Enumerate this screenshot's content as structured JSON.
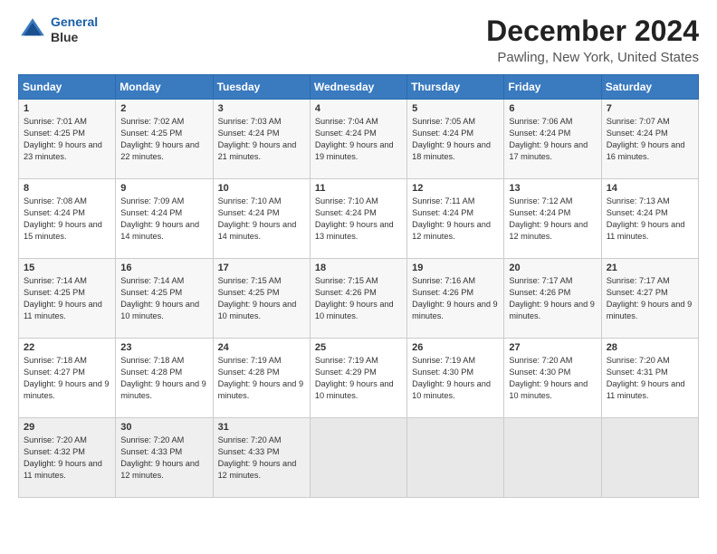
{
  "header": {
    "logo_line1": "General",
    "logo_line2": "Blue",
    "title": "December 2024",
    "subtitle": "Pawling, New York, United States"
  },
  "days_of_week": [
    "Sunday",
    "Monday",
    "Tuesday",
    "Wednesday",
    "Thursday",
    "Friday",
    "Saturday"
  ],
  "weeks": [
    [
      {
        "day": "1",
        "sunrise": "Sunrise: 7:01 AM",
        "sunset": "Sunset: 4:25 PM",
        "daylight": "Daylight: 9 hours and 23 minutes."
      },
      {
        "day": "2",
        "sunrise": "Sunrise: 7:02 AM",
        "sunset": "Sunset: 4:25 PM",
        "daylight": "Daylight: 9 hours and 22 minutes."
      },
      {
        "day": "3",
        "sunrise": "Sunrise: 7:03 AM",
        "sunset": "Sunset: 4:24 PM",
        "daylight": "Daylight: 9 hours and 21 minutes."
      },
      {
        "day": "4",
        "sunrise": "Sunrise: 7:04 AM",
        "sunset": "Sunset: 4:24 PM",
        "daylight": "Daylight: 9 hours and 19 minutes."
      },
      {
        "day": "5",
        "sunrise": "Sunrise: 7:05 AM",
        "sunset": "Sunset: 4:24 PM",
        "daylight": "Daylight: 9 hours and 18 minutes."
      },
      {
        "day": "6",
        "sunrise": "Sunrise: 7:06 AM",
        "sunset": "Sunset: 4:24 PM",
        "daylight": "Daylight: 9 hours and 17 minutes."
      },
      {
        "day": "7",
        "sunrise": "Sunrise: 7:07 AM",
        "sunset": "Sunset: 4:24 PM",
        "daylight": "Daylight: 9 hours and 16 minutes."
      }
    ],
    [
      {
        "day": "8",
        "sunrise": "Sunrise: 7:08 AM",
        "sunset": "Sunset: 4:24 PM",
        "daylight": "Daylight: 9 hours and 15 minutes."
      },
      {
        "day": "9",
        "sunrise": "Sunrise: 7:09 AM",
        "sunset": "Sunset: 4:24 PM",
        "daylight": "Daylight: 9 hours and 14 minutes."
      },
      {
        "day": "10",
        "sunrise": "Sunrise: 7:10 AM",
        "sunset": "Sunset: 4:24 PM",
        "daylight": "Daylight: 9 hours and 14 minutes."
      },
      {
        "day": "11",
        "sunrise": "Sunrise: 7:10 AM",
        "sunset": "Sunset: 4:24 PM",
        "daylight": "Daylight: 9 hours and 13 minutes."
      },
      {
        "day": "12",
        "sunrise": "Sunrise: 7:11 AM",
        "sunset": "Sunset: 4:24 PM",
        "daylight": "Daylight: 9 hours and 12 minutes."
      },
      {
        "day": "13",
        "sunrise": "Sunrise: 7:12 AM",
        "sunset": "Sunset: 4:24 PM",
        "daylight": "Daylight: 9 hours and 12 minutes."
      },
      {
        "day": "14",
        "sunrise": "Sunrise: 7:13 AM",
        "sunset": "Sunset: 4:24 PM",
        "daylight": "Daylight: 9 hours and 11 minutes."
      }
    ],
    [
      {
        "day": "15",
        "sunrise": "Sunrise: 7:14 AM",
        "sunset": "Sunset: 4:25 PM",
        "daylight": "Daylight: 9 hours and 11 minutes."
      },
      {
        "day": "16",
        "sunrise": "Sunrise: 7:14 AM",
        "sunset": "Sunset: 4:25 PM",
        "daylight": "Daylight: 9 hours and 10 minutes."
      },
      {
        "day": "17",
        "sunrise": "Sunrise: 7:15 AM",
        "sunset": "Sunset: 4:25 PM",
        "daylight": "Daylight: 9 hours and 10 minutes."
      },
      {
        "day": "18",
        "sunrise": "Sunrise: 7:15 AM",
        "sunset": "Sunset: 4:26 PM",
        "daylight": "Daylight: 9 hours and 10 minutes."
      },
      {
        "day": "19",
        "sunrise": "Sunrise: 7:16 AM",
        "sunset": "Sunset: 4:26 PM",
        "daylight": "Daylight: 9 hours and 9 minutes."
      },
      {
        "day": "20",
        "sunrise": "Sunrise: 7:17 AM",
        "sunset": "Sunset: 4:26 PM",
        "daylight": "Daylight: 9 hours and 9 minutes."
      },
      {
        "day": "21",
        "sunrise": "Sunrise: 7:17 AM",
        "sunset": "Sunset: 4:27 PM",
        "daylight": "Daylight: 9 hours and 9 minutes."
      }
    ],
    [
      {
        "day": "22",
        "sunrise": "Sunrise: 7:18 AM",
        "sunset": "Sunset: 4:27 PM",
        "daylight": "Daylight: 9 hours and 9 minutes."
      },
      {
        "day": "23",
        "sunrise": "Sunrise: 7:18 AM",
        "sunset": "Sunset: 4:28 PM",
        "daylight": "Daylight: 9 hours and 9 minutes."
      },
      {
        "day": "24",
        "sunrise": "Sunrise: 7:19 AM",
        "sunset": "Sunset: 4:28 PM",
        "daylight": "Daylight: 9 hours and 9 minutes."
      },
      {
        "day": "25",
        "sunrise": "Sunrise: 7:19 AM",
        "sunset": "Sunset: 4:29 PM",
        "daylight": "Daylight: 9 hours and 10 minutes."
      },
      {
        "day": "26",
        "sunrise": "Sunrise: 7:19 AM",
        "sunset": "Sunset: 4:30 PM",
        "daylight": "Daylight: 9 hours and 10 minutes."
      },
      {
        "day": "27",
        "sunrise": "Sunrise: 7:20 AM",
        "sunset": "Sunset: 4:30 PM",
        "daylight": "Daylight: 9 hours and 10 minutes."
      },
      {
        "day": "28",
        "sunrise": "Sunrise: 7:20 AM",
        "sunset": "Sunset: 4:31 PM",
        "daylight": "Daylight: 9 hours and 11 minutes."
      }
    ],
    [
      {
        "day": "29",
        "sunrise": "Sunrise: 7:20 AM",
        "sunset": "Sunset: 4:32 PM",
        "daylight": "Daylight: 9 hours and 11 minutes."
      },
      {
        "day": "30",
        "sunrise": "Sunrise: 7:20 AM",
        "sunset": "Sunset: 4:33 PM",
        "daylight": "Daylight: 9 hours and 12 minutes."
      },
      {
        "day": "31",
        "sunrise": "Sunrise: 7:20 AM",
        "sunset": "Sunset: 4:33 PM",
        "daylight": "Daylight: 9 hours and 12 minutes."
      },
      null,
      null,
      null,
      null
    ]
  ]
}
